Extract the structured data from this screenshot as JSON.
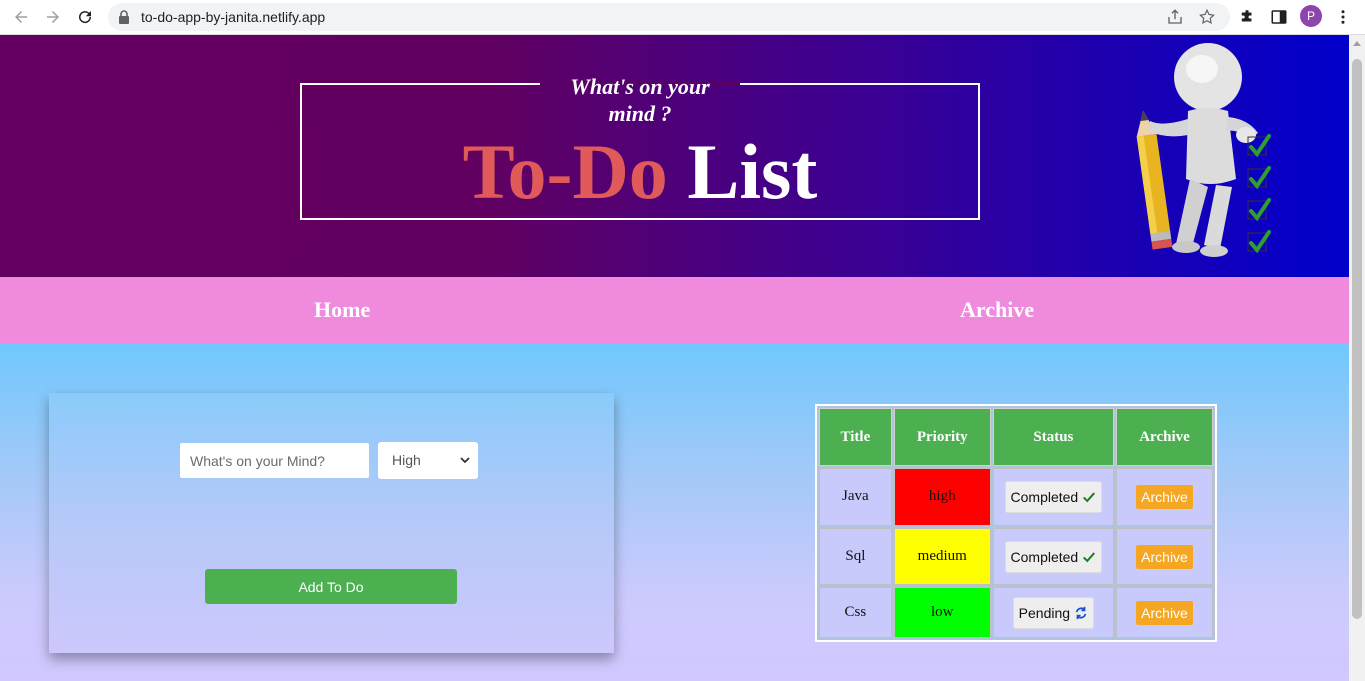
{
  "browser": {
    "url": "to-do-app-by-janita.netlify.app",
    "avatar_letter": "P"
  },
  "header": {
    "tagline_line1": "What's on your",
    "tagline_line2": "mind ?",
    "title_part1": "To-Do",
    "title_part2": "List",
    "colors": {
      "gradient_start": "#640060",
      "gradient_end": "#0000cc",
      "title_accent": "#e05a5a"
    }
  },
  "nav": {
    "home": "Home",
    "archive": "Archive",
    "background": "#f08adc"
  },
  "form": {
    "placeholder": "What's on your Mind?",
    "priority_selected": "High",
    "add_button": "Add To Do",
    "add_button_color": "#4caf50"
  },
  "table": {
    "headers": [
      "Title",
      "Priority",
      "Status",
      "Archive"
    ],
    "rows": [
      {
        "title": "Java",
        "priority": "high",
        "priority_color": "#ff0000",
        "status": "Completed",
        "status_icon": "check-icon",
        "archive": "Archive"
      },
      {
        "title": "Sql",
        "priority": "medium",
        "priority_color": "#ffff00",
        "status": "Completed",
        "status_icon": "check-icon",
        "archive": "Archive"
      },
      {
        "title": "Css",
        "priority": "low",
        "priority_color": "#00ff00",
        "status": "Pending",
        "status_icon": "refresh-icon",
        "archive": "Archive"
      }
    ]
  }
}
